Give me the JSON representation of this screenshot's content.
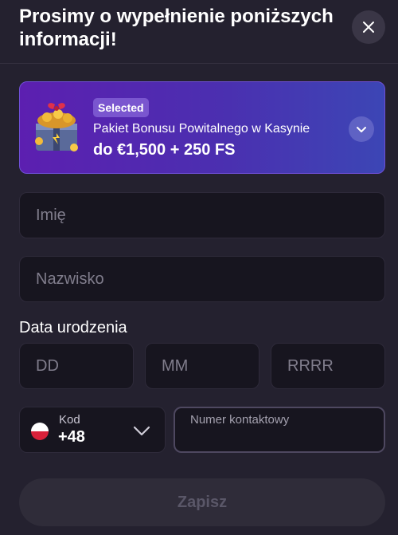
{
  "header": {
    "title": "Prosimy o wypełnienie poniższych informacji!",
    "close_icon": "close-icon"
  },
  "bonus": {
    "badge": "Selected",
    "name": "Pakiet Bonusu Powitalnego w Kasynie",
    "amount": "do €1,500 + 250 FS",
    "image_icon": "treasure-chest-icon",
    "toggle_icon": "chevron-down-icon"
  },
  "form": {
    "first_name_placeholder": "Imię",
    "last_name_placeholder": "Nazwisko",
    "dob_label": "Data urodzenia",
    "day_placeholder": "DD",
    "month_placeholder": "MM",
    "year_placeholder": "RRRR",
    "phone_code_label": "Kod",
    "phone_code_value": "+48",
    "phone_code_flag": "poland-flag-icon",
    "phone_label": "Numer kontaktowy",
    "phone_value": ""
  },
  "actions": {
    "save_label": "Zapisz"
  },
  "colors": {
    "background": "#24212f",
    "field_background": "#17151f",
    "bonus_gradient_start": "#5c1fb0",
    "bonus_gradient_end": "#3c46b5",
    "save_disabled_bg": "#2f2c39",
    "save_disabled_text": "#5a5768"
  }
}
